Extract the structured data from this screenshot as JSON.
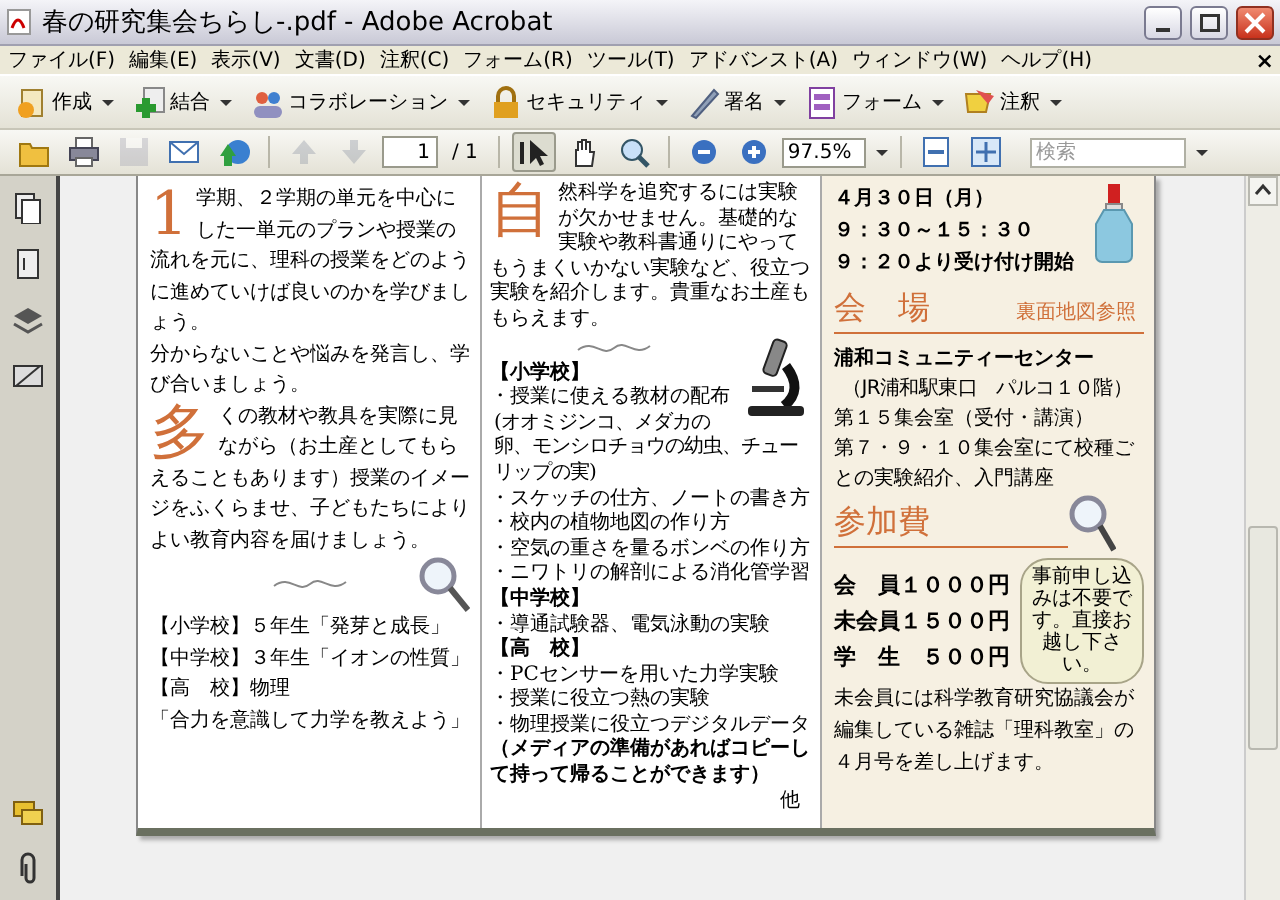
{
  "window": {
    "title": "春の研究集会ちらし-.pdf - Adobe Acrobat"
  },
  "menu": {
    "items": [
      "ファイル(F)",
      "編集(E)",
      "表示(V)",
      "文書(D)",
      "注釈(C)",
      "フォーム(R)",
      "ツール(T)",
      "アドバンスト(A)",
      "ウィンドウ(W)",
      "ヘルプ(H)"
    ],
    "close": "×"
  },
  "toolbar_1": [
    {
      "kind": "create",
      "label": "作成"
    },
    {
      "kind": "combine",
      "label": "結合"
    },
    {
      "kind": "collaborate",
      "label": "コラボレーション"
    },
    {
      "kind": "security",
      "label": "セキュリティ"
    },
    {
      "kind": "sign",
      "label": "署名"
    },
    {
      "kind": "form",
      "label": "フォーム"
    },
    {
      "kind": "comment",
      "label": "注釈"
    }
  ],
  "toolbar_2": [
    {
      "kind": "open",
      "disabled": false
    },
    {
      "kind": "print",
      "disabled": false
    },
    {
      "kind": "save",
      "disabled": true
    },
    {
      "kind": "email",
      "disabled": false
    },
    {
      "kind": "web",
      "disabled": false
    },
    {
      "kind": "sep"
    },
    {
      "kind": "prev",
      "disabled": true
    },
    {
      "kind": "next",
      "disabled": true
    },
    {
      "kind": "page_field",
      "value": "1"
    },
    {
      "kind": "page_count",
      "text": "/ 1"
    },
    {
      "kind": "sep"
    },
    {
      "kind": "select",
      "selected": true
    },
    {
      "kind": "hand",
      "selected": false
    },
    {
      "kind": "zoom_tool",
      "selected": false
    },
    {
      "kind": "sep"
    },
    {
      "kind": "zoom_out",
      "disabled": false
    },
    {
      "kind": "zoom_in",
      "disabled": false
    },
    {
      "kind": "zoom_field",
      "value": "97.5%"
    },
    {
      "kind": "sep"
    },
    {
      "kind": "fit",
      "disabled": false
    },
    {
      "kind": "fullscreen",
      "disabled": false
    },
    {
      "kind": "search_field",
      "placeholder": "検索"
    }
  ],
  "document": {
    "left": {
      "paragraphs": [
        {
          "initial": "1",
          "text": "学期、２学期の単元を中心にした一単元のプランや授業の流れを元に、理科の授業をどのように進めていけば良いのかを学びましょう。"
        },
        {
          "text": "分からないことや悩みを発言し、学び合いましょう。"
        },
        {
          "initial": "多",
          "text": "くの教材や教具を実際に見ながら（お土産としてもらえることもあります）授業のイメージをふくらませ、子どもたちによりよい教育内容を届けましょう。"
        }
      ],
      "lines": [
        "【小学校】５年生「発芽と成長」",
        "【中学校】３年生「イオンの性質」",
        "【高　校】物理",
        "「合力を意識して力学を教えよう」"
      ]
    },
    "middle": {
      "paragraphs": [
        {
          "initial": "自",
          "text": "然科学を追究するには実験が欠かせません。基礎的な実験や教科書通りにやってもうまくいかない実験など、役立つ実験を紹介します。貴重なお土産ももらえます。"
        }
      ],
      "lines": [
        {
          "kind": "heading",
          "text": "【小学校】"
        },
        {
          "kind": "bullet",
          "text": "・授業に使える教材の配布"
        },
        {
          "kind": "note",
          "text": "(オオミジンコ、メダカの卵、モンシロチョウの幼虫、チューリップの実)"
        },
        {
          "kind": "bullet",
          "text": "・スケッチの仕方、ノートの書き方"
        },
        {
          "kind": "bullet",
          "text": "・校内の植物地図の作り方"
        },
        {
          "kind": "bullet",
          "text": "・空気の重さを量るボンベの作り方"
        },
        {
          "kind": "bullet",
          "text": "・ニワトリの解剖による消化管学習"
        },
        {
          "kind": "heading",
          "text": "【中学校】"
        },
        {
          "kind": "bullet",
          "text": "・導通試験器、電気泳動の実験"
        },
        {
          "kind": "heading",
          "text": "【高　校】"
        },
        {
          "kind": "bullet",
          "text": "・PCセンサーを用いた力学実験"
        },
        {
          "kind": "bullet",
          "text": "・授業に役立つ熱の実験"
        },
        {
          "kind": "bullet",
          "text": "・物理授業に役立つデジタルデータ"
        },
        {
          "kind": "paren",
          "text": "（メディアの準備があればコピーして持って帰ることができます）"
        },
        {
          "kind": "right",
          "text": "他"
        }
      ]
    },
    "right": {
      "date": [
        "４月３０日（月）",
        "９：３０～１５：３０",
        "９：２０より受け付け開始"
      ],
      "venue_heading": {
        "title": "会　場",
        "aside": "裏面地図参照"
      },
      "venue": [
        {
          "kind": "bold",
          "text": "浦和コミュニティーセンター"
        },
        {
          "kind": "indent",
          "text": "（JR浦和駅東口　パルコ１０階）"
        },
        {
          "kind": "plain",
          "text": "第１５集会室（受付・講演）"
        },
        {
          "kind": "plain",
          "text": "第７・９・１０集会室にて校種ごとの実験紹介、入門講座"
        }
      ],
      "fee_heading": {
        "title": "参加費"
      },
      "fees": [
        "会　員１０００円",
        "未会員１５００円",
        "学　生　５００円"
      ],
      "note": "未会員には科学教育研究協議会が編集している雑誌「理科教室」の４月号を差し上げます。",
      "bubble": "事前申し込みは不要です。直接お越し下さい。"
    }
  }
}
